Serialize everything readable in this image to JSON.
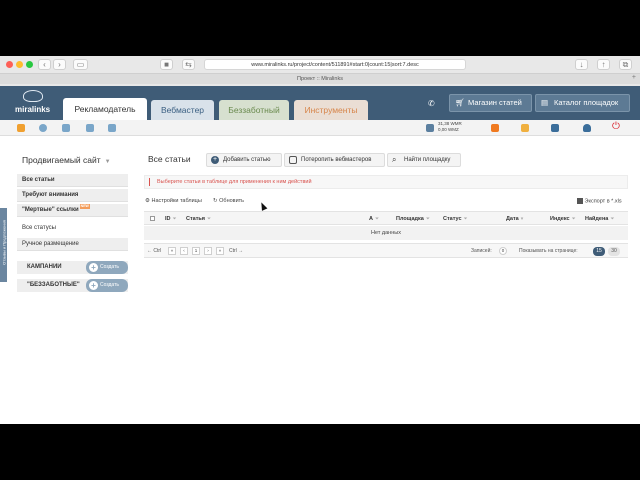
{
  "browser": {
    "url": "www.miralinks.ru/project/content/511891#start:0|count:15|sort:7.desc",
    "tab_title": "Проект :: Miralinks"
  },
  "header": {
    "logo_text": "miralinks",
    "tabs": [
      {
        "label": "Рекламодатель"
      },
      {
        "label": "Вебмастер"
      },
      {
        "label": "Беззаботный"
      },
      {
        "label": "Инструменты"
      }
    ],
    "shop_button": "Магазин статей",
    "catalog_button": "Каталог площадок"
  },
  "toolbar": {
    "wallet_line1": "31,38 WMR",
    "wallet_line2": "0,00 WMZ"
  },
  "sidebar": {
    "title": "Продвигаемый сайт",
    "items": [
      {
        "label": "Все статьи"
      },
      {
        "label": "Требуют внимания"
      },
      {
        "label": "\"Мертвые\" ссылки",
        "badge": "NEW"
      },
      {
        "label": "Все статусы"
      },
      {
        "label": "Ручное размещение"
      }
    ],
    "campaigns_label": "КАМПАНИИ",
    "carefree_label": "\"БЕЗЗАБОТНЫЕ\"",
    "create_label": "Создать",
    "vertical_tab": "Отзывы и Предложения"
  },
  "main": {
    "title": "Все статьи",
    "add_article": "Добавить статью",
    "bother_webmasters": "Потеропить вебмастеров",
    "find_site": "Найти площадку",
    "notice": "Выберите статьи в таблице для применения к ним действий",
    "table_settings": "Настройки таблицы",
    "refresh": "Обновить",
    "export": "Экспорт в *.xls",
    "columns": [
      "ID",
      "Статья",
      "А",
      "Площадка",
      "Статус",
      "Дата",
      "Индекс",
      "Найдена"
    ],
    "no_data": "Нет данных",
    "pager": {
      "prev": "← Ctrl",
      "next": "Ctrl →",
      "page": "1",
      "records_label": "Записей:",
      "records_count": "0",
      "per_page_label": "Показывать на странице:",
      "per_page_options": [
        "15",
        "30"
      ]
    }
  }
}
